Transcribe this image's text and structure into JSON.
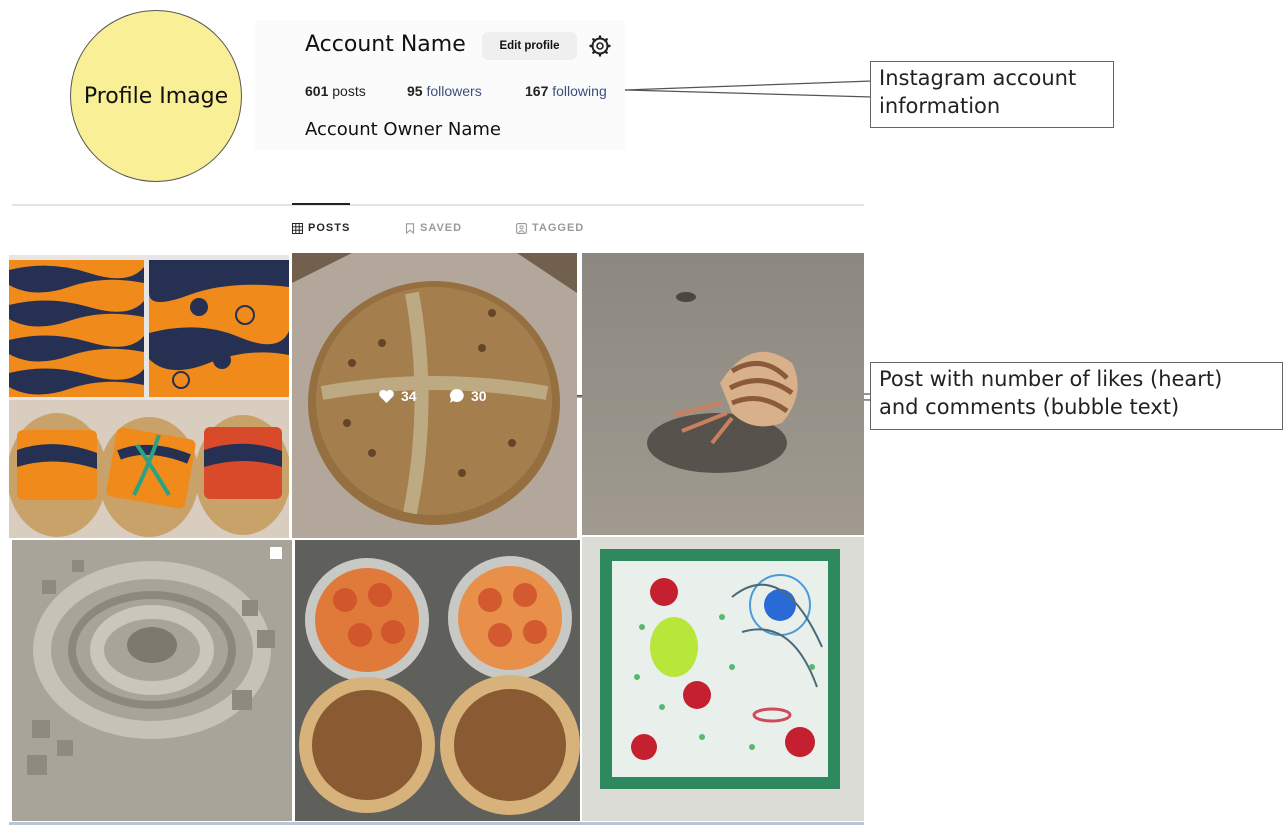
{
  "profile": {
    "avatar_label": "Profile Image",
    "account_name": "Account Name",
    "edit_label": "Edit profile",
    "owner_name": "Account Owner Name"
  },
  "stats": {
    "posts_count": "601",
    "posts_label": "posts",
    "followers_count": "95",
    "followers_label": "followers",
    "following_count": "167",
    "following_label": "following"
  },
  "tabs": [
    {
      "label": "POSTS",
      "icon": "grid-icon",
      "active": true
    },
    {
      "label": "SAVED",
      "icon": "bookmark-icon",
      "active": false
    },
    {
      "label": "TAGGED",
      "icon": "tag-person-icon",
      "active": false
    }
  ],
  "callouts": {
    "account_info": [
      "Instagram account",
      "information"
    ],
    "post_info": [
      "Post with number of likes (heart)",
      "and comments (bubble text)"
    ]
  },
  "posts": [
    {
      "subject": "orange and navy patterned fabric cakes"
    },
    {
      "subject": "sourdough bread loaf",
      "likes": "34",
      "comments": "30"
    },
    {
      "subject": "hermit crab on sand"
    },
    {
      "subject": "sand spiral sculpture"
    },
    {
      "subject": "citrus tarts and pies"
    },
    {
      "subject": "resin model of a cell"
    }
  ],
  "colors": {
    "avatar_fill": "#f9ef96",
    "link_blue": "#3a4f7a",
    "edit_button_bg": "#efefef"
  }
}
